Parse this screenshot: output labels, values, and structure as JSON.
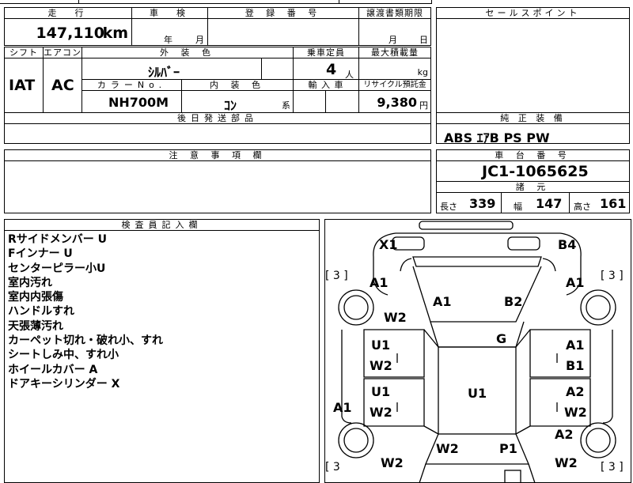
{
  "header": {
    "mileage_label": "走　行",
    "mileage_value": "147,110",
    "mileage_unit": "km",
    "inspection_label": "車　検",
    "inspection_year": "年",
    "inspection_month": "月",
    "registration_label": "登 録 番 号",
    "transfer_doc_label": "譲渡書類期限",
    "transfer_month": "月",
    "transfer_day": "日",
    "sales_point_label": "セールスポイント"
  },
  "spec": {
    "shift_label": "シフト",
    "shift_value": "IAT",
    "ac_label": "エアコン",
    "ac_value": "AC",
    "exterior_color_label": "外 装 色",
    "exterior_color_value": "ｼﾙﾊﾞｰ",
    "capacity_label": "乗車定員",
    "capacity_value": "4",
    "capacity_unit": "人",
    "max_load_label": "最大積載量",
    "max_load_unit": "kg",
    "color_no_label": "カラーNo.",
    "color_no_value": "NH700M",
    "interior_color_label": "内 装 色",
    "interior_color_value": "ｺﾝ",
    "interior_color_suffix": "系",
    "import_label": "輸 入 車",
    "recycle_label": "リサイクル預託金",
    "recycle_value": "9,380",
    "recycle_unit": "円",
    "later_parts_label": "後日発送部品",
    "genuine_equipment_label": "純 正 装 備",
    "genuine_equipment_value": "ABS ｴｱB PS PW"
  },
  "notes_section": {
    "caution_label": "注 意 事 項 欄",
    "chassis_label": "車 台 番 号",
    "chassis_value": "JC1-1065625",
    "dimensions_label": "諸 元",
    "length_label": "長さ",
    "length_value": "339",
    "width_label": "幅",
    "width_value": "147",
    "height_label": "高さ",
    "height_value": "161",
    "inspector_label": "検査員記入欄",
    "inspector_notes": [
      "Rサイドメンバー U",
      "Fインナー U",
      "センターピラー小U",
      "室内汚れ",
      "室内内張傷",
      "ハンドルすれ",
      "天張薄汚れ",
      "カーペット切れ・破れ小、すれ",
      "シートしみ中、すれ小",
      "ホイールカバー A",
      "ドアキーシリンダー X"
    ]
  },
  "diagram": {
    "bracket_left": "[ 3 ]",
    "bracket_right": "[ 3 ]",
    "bracket_bottom_left": "[ 3",
    "bracket_bottom_right": "[ 3 ]",
    "front_bumper_left": "X1",
    "front_bumper_right": "B4",
    "front_fender_left": "A1",
    "front_fender_right": "A1",
    "hood_left": "A1",
    "hood_right": "B2",
    "front_wheel_left": "W2",
    "roof": "G",
    "front_door_left_top": "U1",
    "front_door_left_bottom": "W2",
    "front_door_right_top": "A1",
    "front_door_right_bottom": "B1",
    "rear_door_left_top": "U1",
    "rear_door_left_bottom": "W2",
    "rear_door_right_top": "A2",
    "rear_door_right_bottom": "W2",
    "floor": "U1",
    "rocker_left": "A1",
    "rear_fender_right": "A2",
    "rear_left": "W2",
    "rear_right": "P1",
    "rear_wheel_left": "W2",
    "rear_wheel_right": "W2"
  }
}
